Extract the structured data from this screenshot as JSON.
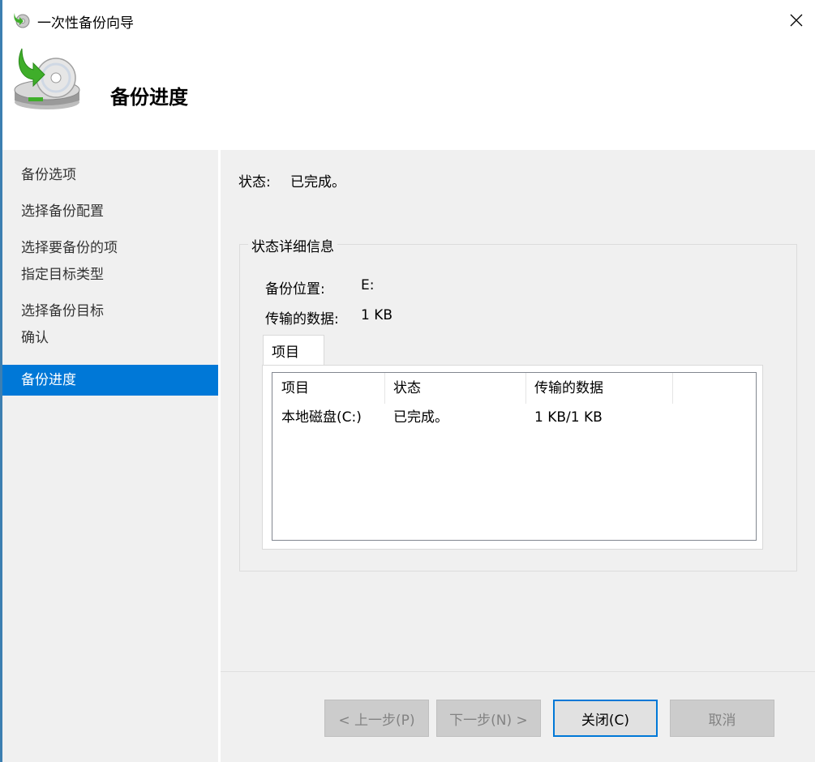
{
  "window": {
    "title": "一次性备份向导",
    "close_glyph": "✕"
  },
  "header": {
    "heading": "备份进度",
    "icon": "backup-disk-icon"
  },
  "sidebar": {
    "items": [
      {
        "label": "备份选项",
        "active": false
      },
      {
        "label": "选择备份配置",
        "active": false
      },
      {
        "label": "选择要备份的项",
        "active": false
      },
      {
        "label": "指定目标类型",
        "active": false
      },
      {
        "label": "选择备份目标",
        "active": false
      },
      {
        "label": "确认",
        "active": false
      },
      {
        "label": "备份进度",
        "active": true
      }
    ]
  },
  "main": {
    "status_label": "状态:",
    "status_value": "已完成。",
    "details": {
      "group_title": "状态详细信息",
      "location_label": "备份位置:",
      "location_value": "E:",
      "transferred_label": "传输的数据:",
      "transferred_value": "1 KB",
      "tab_label": "项目",
      "columns": [
        "项目",
        "状态",
        "传输的数据"
      ],
      "rows": [
        [
          "本地磁盘(C:)",
          "已完成。",
          "1 KB/1 KB"
        ]
      ]
    }
  },
  "footer": {
    "prev_label": "< 上一步(P)",
    "next_label": "下一步(N) >",
    "close_label": "关闭(C)",
    "cancel_label": "取消"
  },
  "colors": {
    "accent": "#0078d7",
    "panel": "#f0f0f0"
  }
}
